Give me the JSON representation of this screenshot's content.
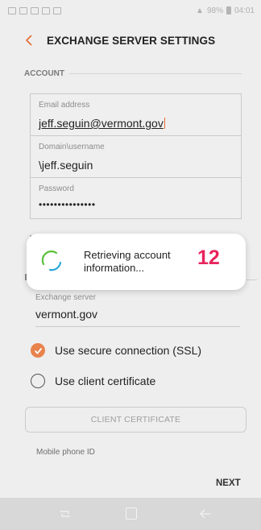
{
  "status_bar": {
    "battery_text": "98%",
    "time": "04:01"
  },
  "header": {
    "title": "EXCHANGE SERVER SETTINGS",
    "back_icon": "chevron-left-icon",
    "accent": "#e66a2e"
  },
  "account": {
    "section_label": "ACCOUNT",
    "email": {
      "label": "Email address",
      "value": "jeff.seguin@vermont.gov"
    },
    "username": {
      "label": "Domain\\username",
      "value": "\\jeff.seguin"
    },
    "password": {
      "label": "Password",
      "value": "•••••••••••••••"
    }
  },
  "dialog": {
    "message": "Retrieving account information...",
    "step_number": "12",
    "step_color": "#e8245c"
  },
  "server": {
    "label": "Exchange server",
    "value": "vermont.gov"
  },
  "options": [
    {
      "label": "Use secure connection (SSL)",
      "checked": true
    },
    {
      "label": "Use client certificate",
      "checked": false
    }
  ],
  "client_certificate_button": "CLIENT CERTIFICATE",
  "mobile_phone_id_label": "Mobile phone ID",
  "next_label": "NEXT",
  "nav": {
    "recent_icon": "recent-apps-icon",
    "home_icon": "home-icon",
    "back_icon": "back-arrow-icon"
  }
}
